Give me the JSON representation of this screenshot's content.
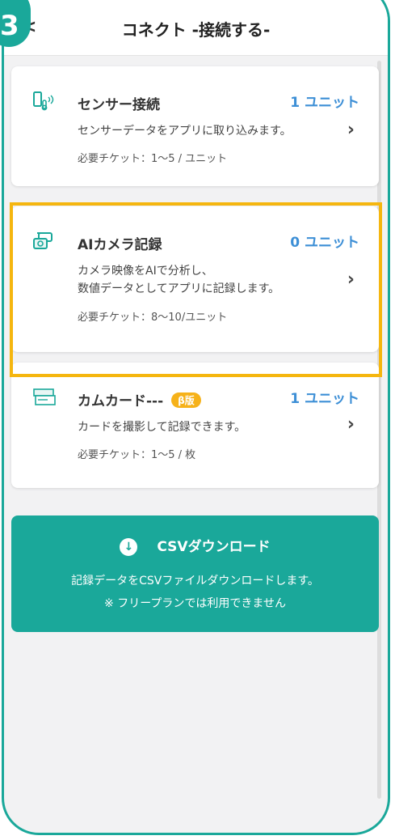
{
  "header": {
    "back_icon": "<",
    "title": "コネクト -接続する-",
    "step_number": "3"
  },
  "cards": [
    {
      "name": "センサー接続",
      "count": "1 ユニット",
      "desc_lines": [
        "センサーデータをアプリに取り込みます。"
      ],
      "ticket": "必要チケット：1～5 / ユニット",
      "icon": "sensor-icon"
    },
    {
      "name": "AIカメラ記録",
      "count": "0 ユニット",
      "desc_lines": [
        "カメラ映像をAIで分析し、",
        "数値データとしてアプリに記録します。"
      ],
      "ticket": "必要チケット：8〜10/ユニット",
      "icon": "camera-icon"
    },
    {
      "name": "カムカード---",
      "badge": "β版",
      "count": "1 ユニット",
      "desc_lines": [
        "カードを撮影して記録できます。"
      ],
      "ticket": "必要チケット：1～5 / 枚",
      "icon": "card-icon"
    }
  ],
  "csv": {
    "title": "CSVダウンロード",
    "line1": "記録データをCSVファイルダウンロードします。",
    "line2": "※ フリープランでは利用できません",
    "icon": "download-icon"
  },
  "colors": {
    "accent": "#1aa89a",
    "highlight": "#f5b60f",
    "count": "#3d8fd6"
  }
}
